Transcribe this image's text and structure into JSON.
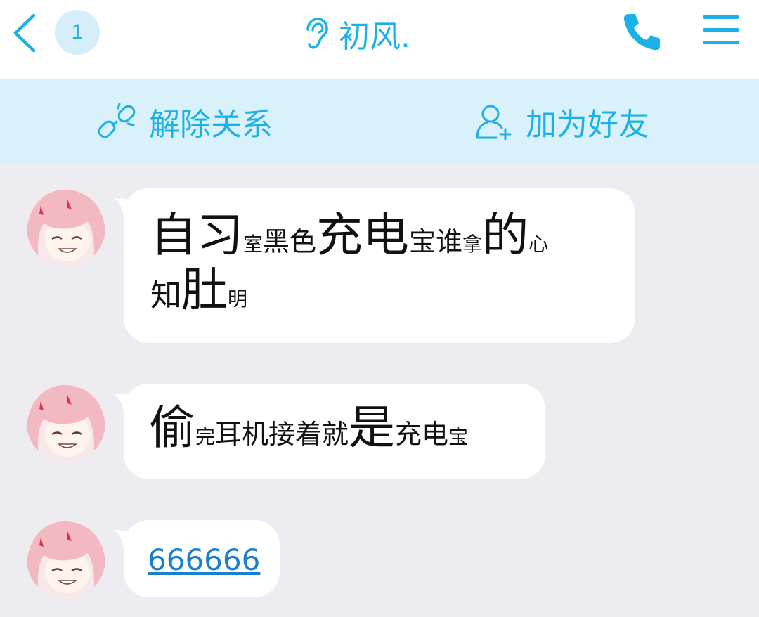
{
  "header": {
    "unread_count": "1",
    "title": "初风.",
    "icons": {
      "back": "chevron-left-icon",
      "voice_mode": "ear-icon",
      "call": "phone-icon",
      "menu": "hamburger-menu-icon"
    }
  },
  "actions": {
    "unfriend": {
      "label": "解除关系",
      "icon": "broken-link-icon"
    },
    "add_friend": {
      "label": "加为好友",
      "icon": "add-user-icon"
    }
  },
  "colors": {
    "accent": "#1cb1e6",
    "action_bar_bg": "#d8f1fb",
    "chat_bg": "#ececf1",
    "bubble_bg": "#ffffff",
    "link": "#1b7fd0"
  },
  "messages": [
    {
      "sender": "avatar",
      "segments": [
        {
          "text": "自习",
          "size": "big"
        },
        {
          "text": "室",
          "size": "xs"
        },
        {
          "text": "黑色",
          "size": "sm"
        },
        {
          "text": "充电",
          "size": "big"
        },
        {
          "text": "宝谁",
          "size": "sm"
        },
        {
          "text": "拿",
          "size": "xs"
        },
        {
          "text": "的",
          "size": "big"
        },
        {
          "text": "心",
          "size": "xs"
        },
        {
          "text": "知",
          "size": "mid"
        },
        {
          "text": "肚",
          "size": "big"
        },
        {
          "text": "明",
          "size": "xs"
        }
      ]
    },
    {
      "sender": "avatar",
      "segments": [
        {
          "text": "偷",
          "size": "big"
        },
        {
          "text": "完",
          "size": "xs"
        },
        {
          "text": "耳机接着就",
          "size": "sm"
        },
        {
          "text": "是",
          "size": "big"
        },
        {
          "text": "充电",
          "size": "sm"
        },
        {
          "text": "宝",
          "size": "xs"
        }
      ]
    },
    {
      "sender": "avatar",
      "link": "666666"
    }
  ]
}
